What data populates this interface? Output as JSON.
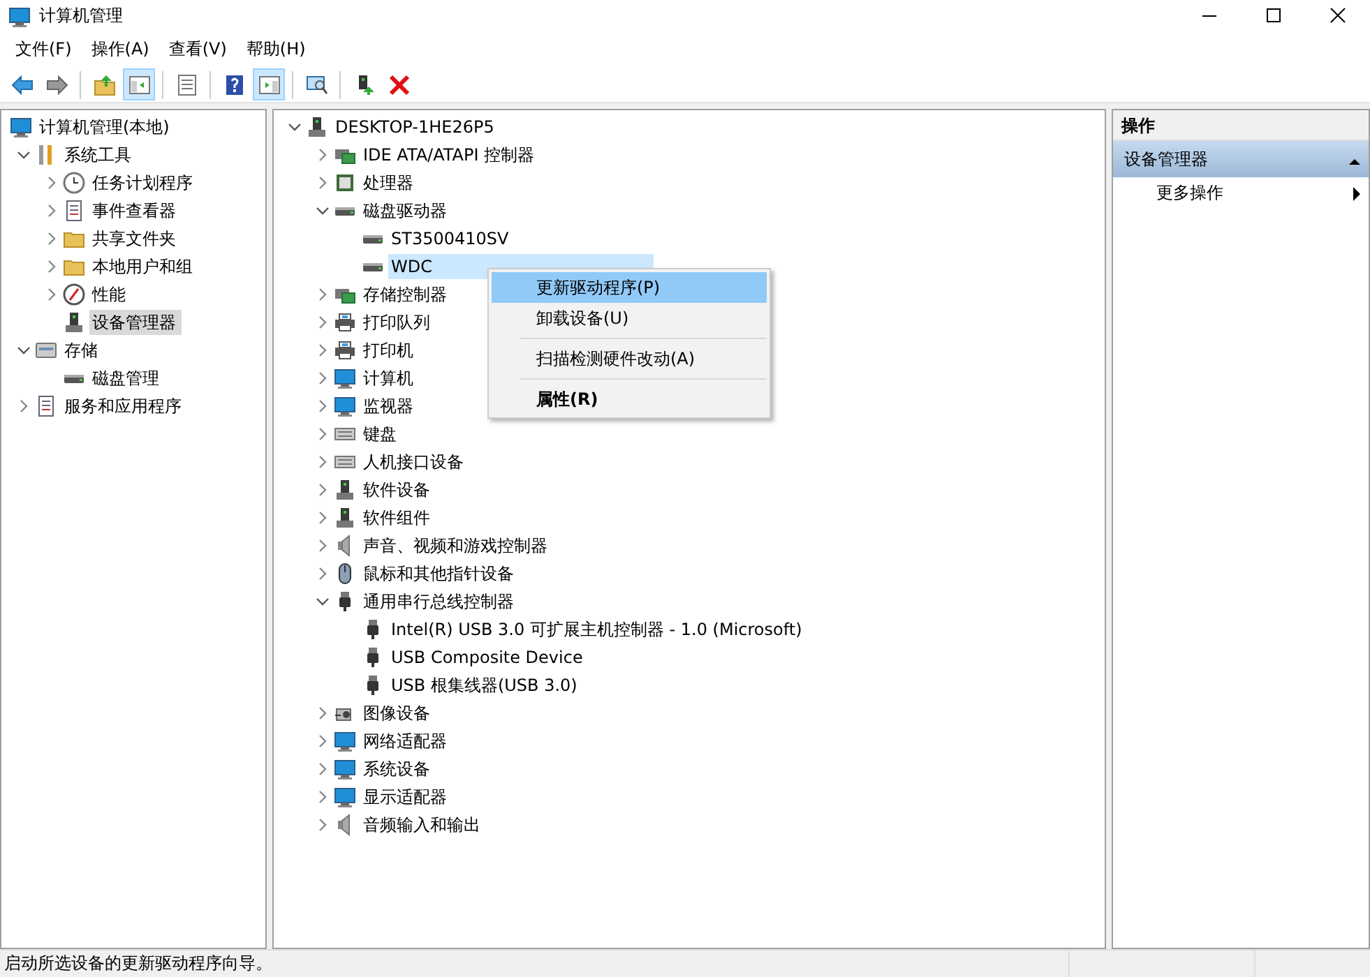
{
  "window": {
    "title": "计算机管理"
  },
  "menu": [
    "文件(F)",
    "操作(A)",
    "查看(V)",
    "帮助(H)"
  ],
  "toolbar": [
    {
      "kind": "back",
      "pressed": false
    },
    {
      "kind": "forward",
      "pressed": false
    },
    {
      "kind": "sep"
    },
    {
      "kind": "up",
      "pressed": false
    },
    {
      "kind": "tree",
      "pressed": true
    },
    {
      "kind": "sep"
    },
    {
      "kind": "props",
      "pressed": false
    },
    {
      "kind": "sep"
    },
    {
      "kind": "help",
      "pressed": false
    },
    {
      "kind": "pane",
      "pressed": true
    },
    {
      "kind": "sep"
    },
    {
      "kind": "scan",
      "pressed": false
    },
    {
      "kind": "sep"
    },
    {
      "kind": "update",
      "pressed": false
    },
    {
      "kind": "delete",
      "pressed": false
    }
  ],
  "sidebar": {
    "items": [
      {
        "label": "计算机管理(本地)",
        "selected": false,
        "children": [
          {
            "label": "系统工具",
            "expanded": true,
            "selected": false,
            "children": [
              {
                "label": "任务计划程序",
                "expanded": false,
                "selected": false
              },
              {
                "label": "事件查看器",
                "expanded": false,
                "selected": false
              },
              {
                "label": "共享文件夹",
                "expanded": false,
                "selected": false
              },
              {
                "label": "本地用户和组",
                "expanded": false,
                "selected": false
              },
              {
                "label": "性能",
                "expanded": false,
                "selected": false
              },
              {
                "label": "设备管理器",
                "selected": true
              }
            ]
          },
          {
            "label": "存储",
            "expanded": true,
            "selected": false,
            "children": [
              {
                "label": "磁盘管理",
                "selected": false
              }
            ]
          },
          {
            "label": "服务和应用程序",
            "expanded": false,
            "selected": false
          }
        ]
      }
    ]
  },
  "device_tree": {
    "items": [
      {
        "label": "DESKTOP-1HE26P5",
        "expanded": true,
        "selected": false,
        "children": [
          {
            "label": "IDE ATA/ATAPI 控制器",
            "expanded": false,
            "selected": false
          },
          {
            "label": "处理器",
            "expanded": false,
            "selected": false
          },
          {
            "label": "磁盘驱动器",
            "expanded": true,
            "selected": false,
            "children": [
              {
                "label": "ST3500410SV",
                "selected": false
              },
              {
                "label": "WDC",
                "selected": true
              }
            ]
          },
          {
            "label": "存储控制器",
            "expanded": false,
            "selected": false
          },
          {
            "label": "打印队列",
            "expanded": false,
            "selected": false
          },
          {
            "label": "打印机",
            "expanded": false,
            "selected": false
          },
          {
            "label": "计算机",
            "expanded": false,
            "selected": false
          },
          {
            "label": "监视器",
            "expanded": false,
            "selected": false
          },
          {
            "label": "键盘",
            "expanded": false,
            "selected": false
          },
          {
            "label": "人机接口设备",
            "expanded": false,
            "selected": false
          },
          {
            "label": "软件设备",
            "expanded": false,
            "selected": false
          },
          {
            "label": "软件组件",
            "expanded": false,
            "selected": false
          },
          {
            "label": "声音、视频和游戏控制器",
            "expanded": false,
            "selected": false
          },
          {
            "label": "鼠标和其他指针设备",
            "expanded": false,
            "selected": false
          },
          {
            "label": "通用串行总线控制器",
            "expanded": true,
            "selected": false,
            "children": [
              {
                "label": "Intel(R) USB 3.0 可扩展主机控制器 - 1.0 (Microsoft)",
                "selected": false
              },
              {
                "label": "USB Composite Device",
                "selected": false
              },
              {
                "label": "USB 根集线器(USB 3.0)",
                "selected": false
              }
            ]
          },
          {
            "label": "图像设备",
            "expanded": false,
            "selected": false
          },
          {
            "label": "网络适配器",
            "expanded": false,
            "selected": false
          },
          {
            "label": "系统设备",
            "expanded": false,
            "selected": false
          },
          {
            "label": "显示适配器",
            "expanded": false,
            "selected": false
          },
          {
            "label": "音频输入和输出",
            "expanded": false,
            "selected": false
          }
        ]
      }
    ]
  },
  "context_menu": [
    {
      "kind": "item",
      "label": "更新驱动程序(P)",
      "selected": true,
      "default": false
    },
    {
      "kind": "item",
      "label": "卸载设备(U)",
      "selected": false,
      "default": false
    },
    {
      "kind": "separator"
    },
    {
      "kind": "item",
      "label": "扫描检测硬件改动(A)",
      "selected": false,
      "default": false
    },
    {
      "kind": "separator"
    },
    {
      "kind": "item",
      "label": "属性(R)",
      "selected": false,
      "default": true
    }
  ],
  "actions": {
    "title": "操作",
    "section": {
      "label": "设备管理器",
      "expanded": true
    },
    "items": [
      {
        "label": "更多操作"
      }
    ]
  },
  "status_bar": "启动所选设备的更新驱动程序向导。"
}
